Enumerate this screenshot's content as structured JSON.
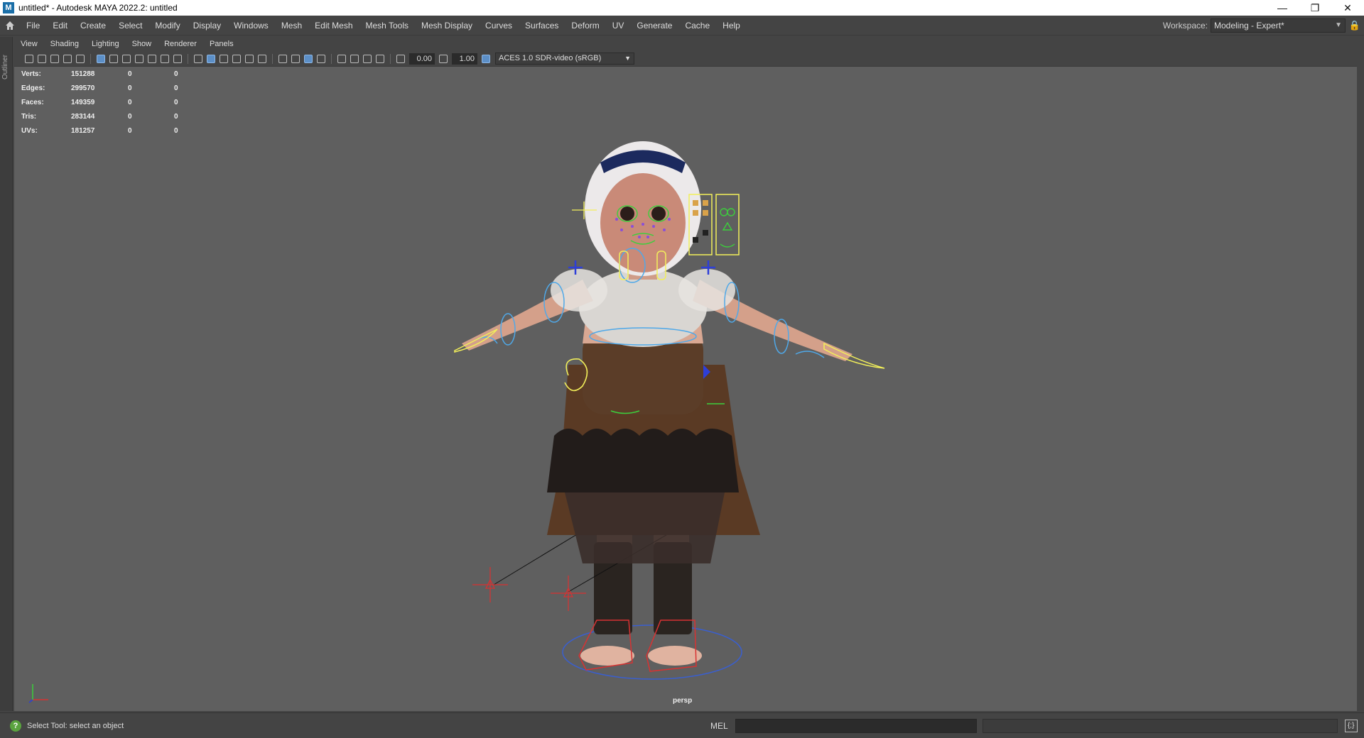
{
  "window": {
    "title": "untitled* - Autodesk MAYA 2022.2: untitled",
    "logo": "M",
    "minimize_icon": "minimize-icon",
    "maximize_icon": "restore-icon",
    "close_icon": "close-icon"
  },
  "menubar": {
    "items": [
      "File",
      "Edit",
      "Create",
      "Select",
      "Modify",
      "Display",
      "Windows",
      "Mesh",
      "Edit Mesh",
      "Mesh Tools",
      "Mesh Display",
      "Curves",
      "Surfaces",
      "Deform",
      "UV",
      "Generate",
      "Cache",
      "Help"
    ],
    "workspace_label": "Workspace:",
    "workspace_value": "Modeling - Expert*"
  },
  "outliner_tab": "Outliner",
  "panel_menu": [
    "View",
    "Shading",
    "Lighting",
    "Show",
    "Renderer",
    "Panels"
  ],
  "panel_toolbar": {
    "exposure": "0.00",
    "gamma": "1.00",
    "color_space": "ACES 1.0 SDR-video (sRGB)"
  },
  "hud": {
    "rows": [
      {
        "label": "Verts:",
        "v1": "151288",
        "v2": "0",
        "v3": "0"
      },
      {
        "label": "Edges:",
        "v1": "299570",
        "v2": "0",
        "v3": "0"
      },
      {
        "label": "Faces:",
        "v1": "149359",
        "v2": "0",
        "v3": "0"
      },
      {
        "label": "Tris:",
        "v1": "283144",
        "v2": "0",
        "v3": "0"
      },
      {
        "label": "UVs:",
        "v1": "181257",
        "v2": "0",
        "v3": "0"
      }
    ]
  },
  "camera_label": "persp",
  "statusbar": {
    "help_text": "Select Tool: select an object",
    "mel_label": "MEL"
  },
  "colors": {
    "viewport_bg": "#5f5f5f",
    "control_blue": "#4fa8e8",
    "control_yellow": "#f2ef5a",
    "control_green": "#3ccf3c",
    "control_red": "#e23a3a"
  }
}
